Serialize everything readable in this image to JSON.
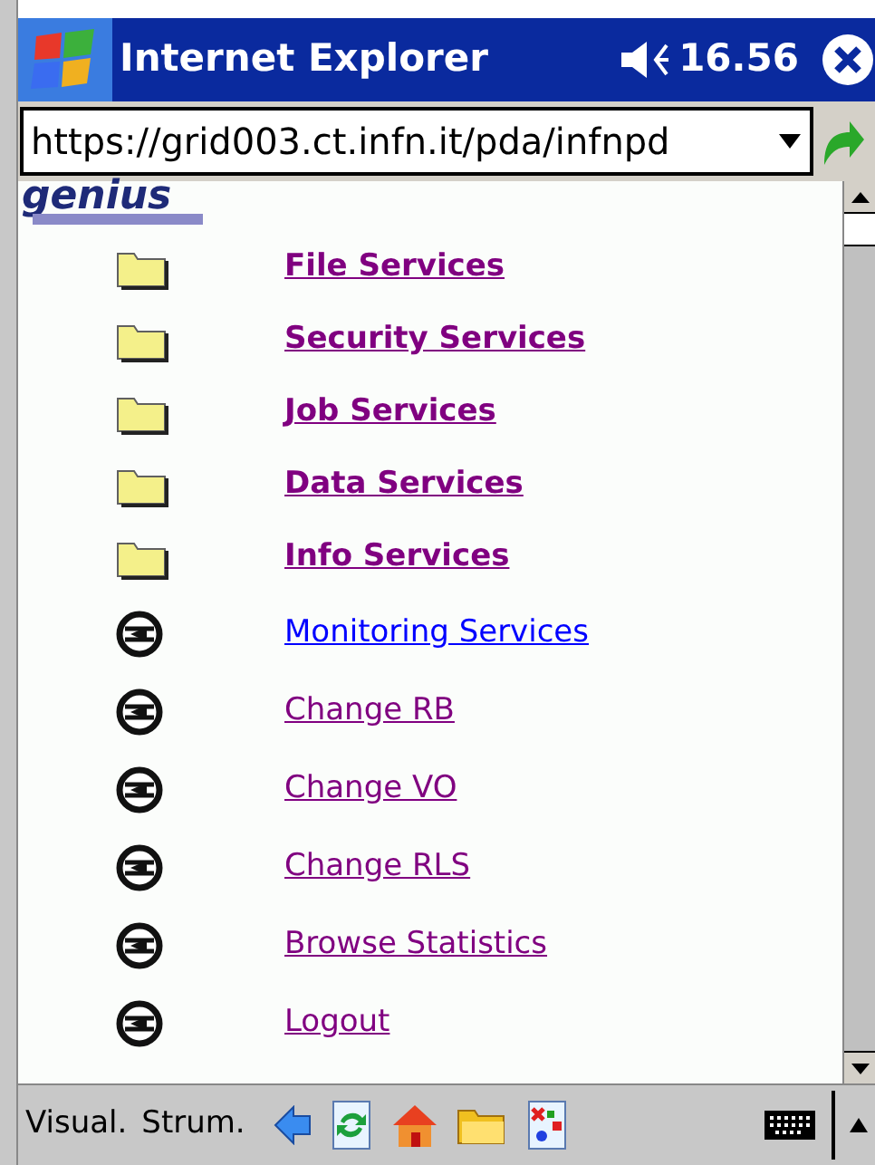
{
  "title_bar": {
    "title": "Internet Explorer",
    "time": "16.56"
  },
  "address_bar": {
    "value": "https://grid003.ct.infn.it/pda/infnpd"
  },
  "logo": {
    "text": "genius"
  },
  "menu": [
    {
      "kind": "folder",
      "label": "File Services",
      "visited": true
    },
    {
      "kind": "folder",
      "label": "Security Services",
      "visited": true
    },
    {
      "kind": "folder",
      "label": "Job Services",
      "visited": true
    },
    {
      "kind": "folder",
      "label": "Data Services",
      "visited": true
    },
    {
      "kind": "folder",
      "label": "Info Services",
      "visited": true
    },
    {
      "kind": "service",
      "label": "Monitoring Services",
      "visited": false
    },
    {
      "kind": "service",
      "label": "Change RB",
      "visited": true
    },
    {
      "kind": "service",
      "label": "Change VO",
      "visited": true
    },
    {
      "kind": "service",
      "label": "Change RLS",
      "visited": true
    },
    {
      "kind": "service",
      "label": "Browse Statistics",
      "visited": true
    },
    {
      "kind": "service",
      "label": "Logout",
      "visited": true
    }
  ],
  "command_bar": {
    "menus": [
      "Visual.",
      "Strum."
    ]
  }
}
